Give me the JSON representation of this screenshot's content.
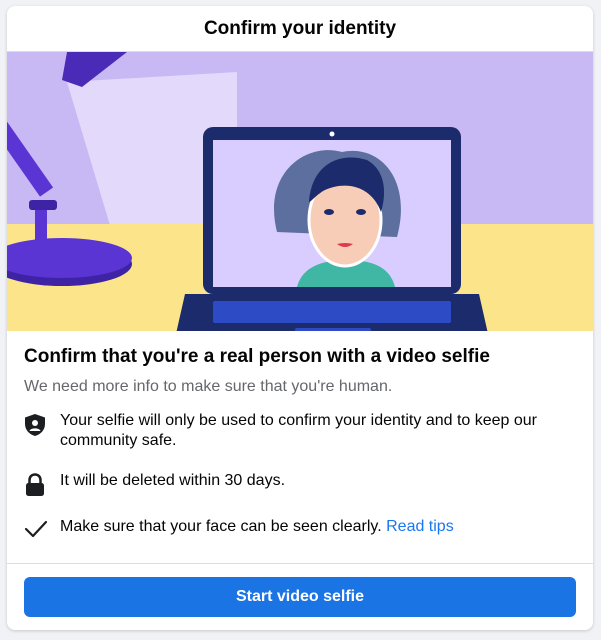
{
  "dialog": {
    "title": "Confirm your identity"
  },
  "main": {
    "headline": "Confirm that you're a real person with a video selfie",
    "subtext": "We need more info to make sure that you're human.",
    "items": [
      {
        "icon": "shield-person-icon",
        "text": "Your selfie will only be used to confirm your identity and to keep our community safe."
      },
      {
        "icon": "lock-icon",
        "text": "It will be deleted within 30 days."
      },
      {
        "icon": "checkmark-icon",
        "text": "Make sure that your face can be seen clearly.",
        "link": "Read tips"
      }
    ]
  },
  "footer": {
    "button_label": "Start video selfie"
  },
  "colors": {
    "primary": "#1b74e4",
    "link": "#1877f2",
    "illustration_bg": "#c8b9f5",
    "desk": "#fbe48a",
    "laptop": "#1c2b6b"
  }
}
